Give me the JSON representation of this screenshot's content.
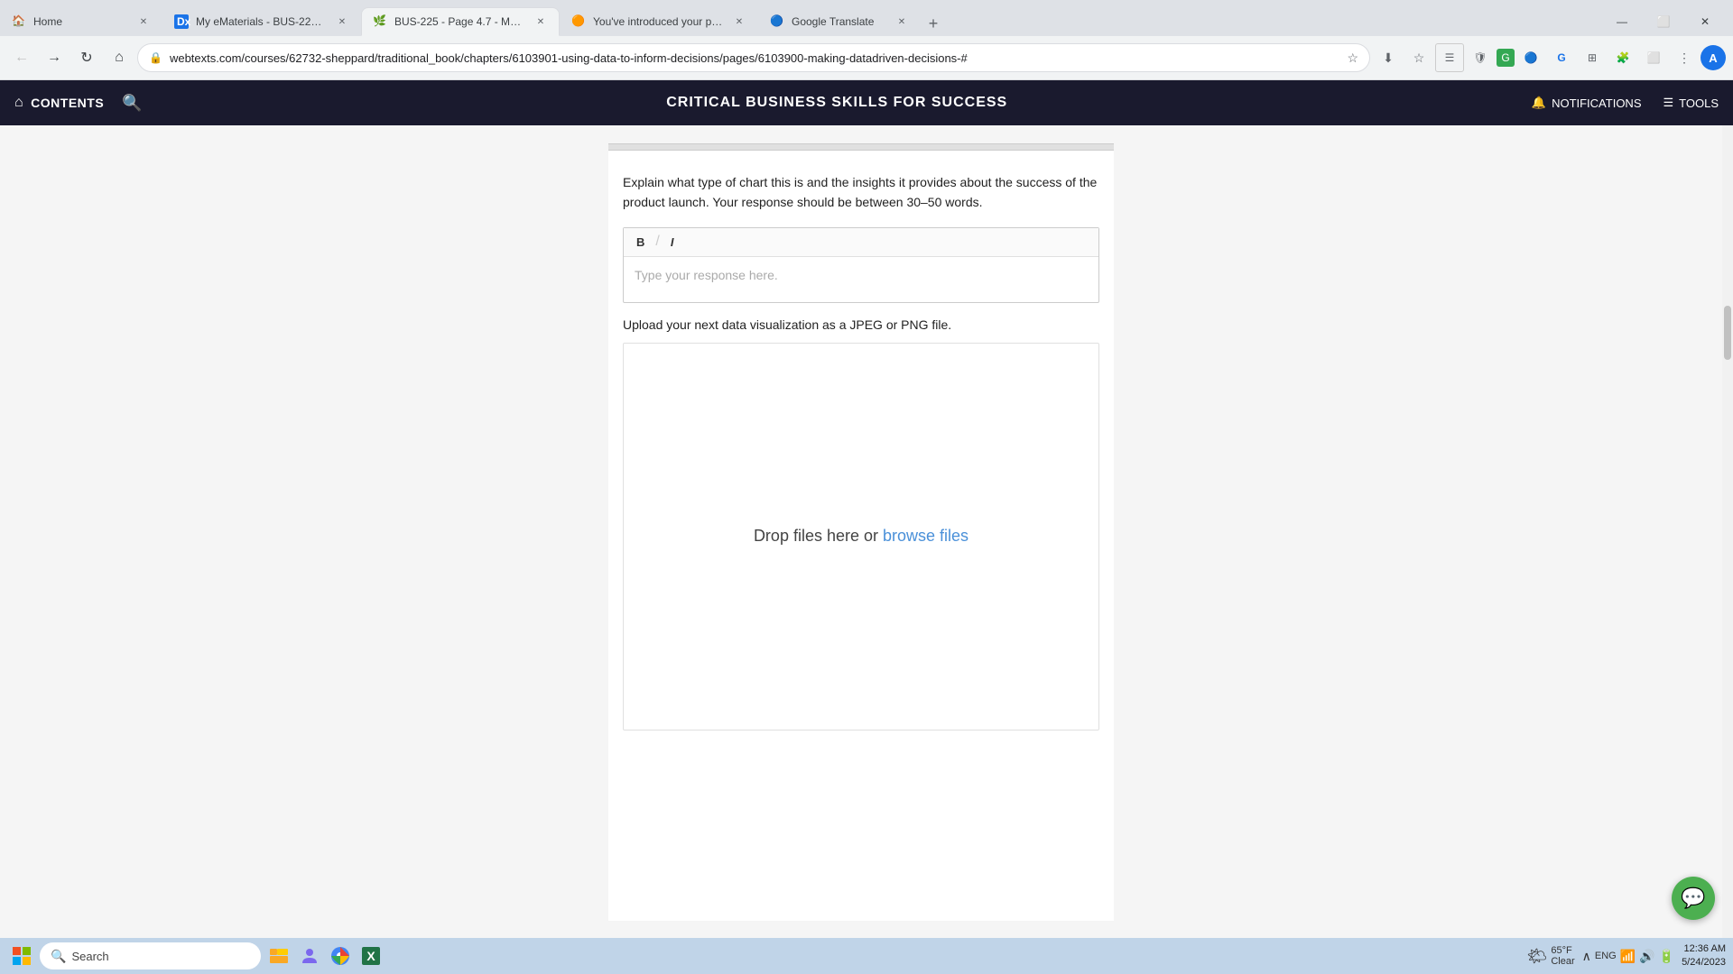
{
  "browser": {
    "tabs": [
      {
        "id": "tab-home",
        "label": "Home",
        "icon": "🏠",
        "active": false,
        "favicon_color": "#4285f4"
      },
      {
        "id": "tab-ematerials",
        "label": "My eMaterials - BUS-225-T5028...",
        "icon": "📄",
        "active": false,
        "favicon_color": "#1a73e8"
      },
      {
        "id": "tab-page47",
        "label": "BUS-225 - Page 4.7 - Making Da...",
        "icon": "📗",
        "active": true,
        "favicon_color": "#34a853"
      },
      {
        "id": "tab-introduced",
        "label": "You've introduced your post by ...",
        "icon": "🟠",
        "active": false,
        "favicon_color": "#ea4335"
      },
      {
        "id": "tab-translate",
        "label": "Google Translate",
        "icon": "🔵",
        "active": false,
        "favicon_color": "#4285f4"
      }
    ],
    "address": "webtexts.com/courses/62732-sheppard/traditional_book/chapters/6103901-using-data-to-inform-decisions/pages/6103900-making-datadriven-decisions-#"
  },
  "app_header": {
    "contents_label": "CONTENTS",
    "title": "CRITICAL BUSINESS SKILLS FOR SUCCESS",
    "notifications_label": "NOTIFICATIONS",
    "tools_label": "TOOLS"
  },
  "main": {
    "question_text": "Explain what type of chart this is and the insights it provides about the success of the product launch. Your response should be between 30–50 words.",
    "toolbar": {
      "bold_label": "B",
      "italic_label": "I"
    },
    "response_placeholder": "Type your response here.",
    "upload_label": "Upload your next data visualization as a JPEG or PNG file.",
    "upload_zone_text_prefix": "Drop files here or ",
    "upload_browse_link": "browse files"
  },
  "taskbar": {
    "search_placeholder": "Search",
    "time": "12:36 AM",
    "date": "5/24/2023",
    "language": "ENG",
    "weather_temp": "65°F",
    "weather_condition": "Clear"
  }
}
